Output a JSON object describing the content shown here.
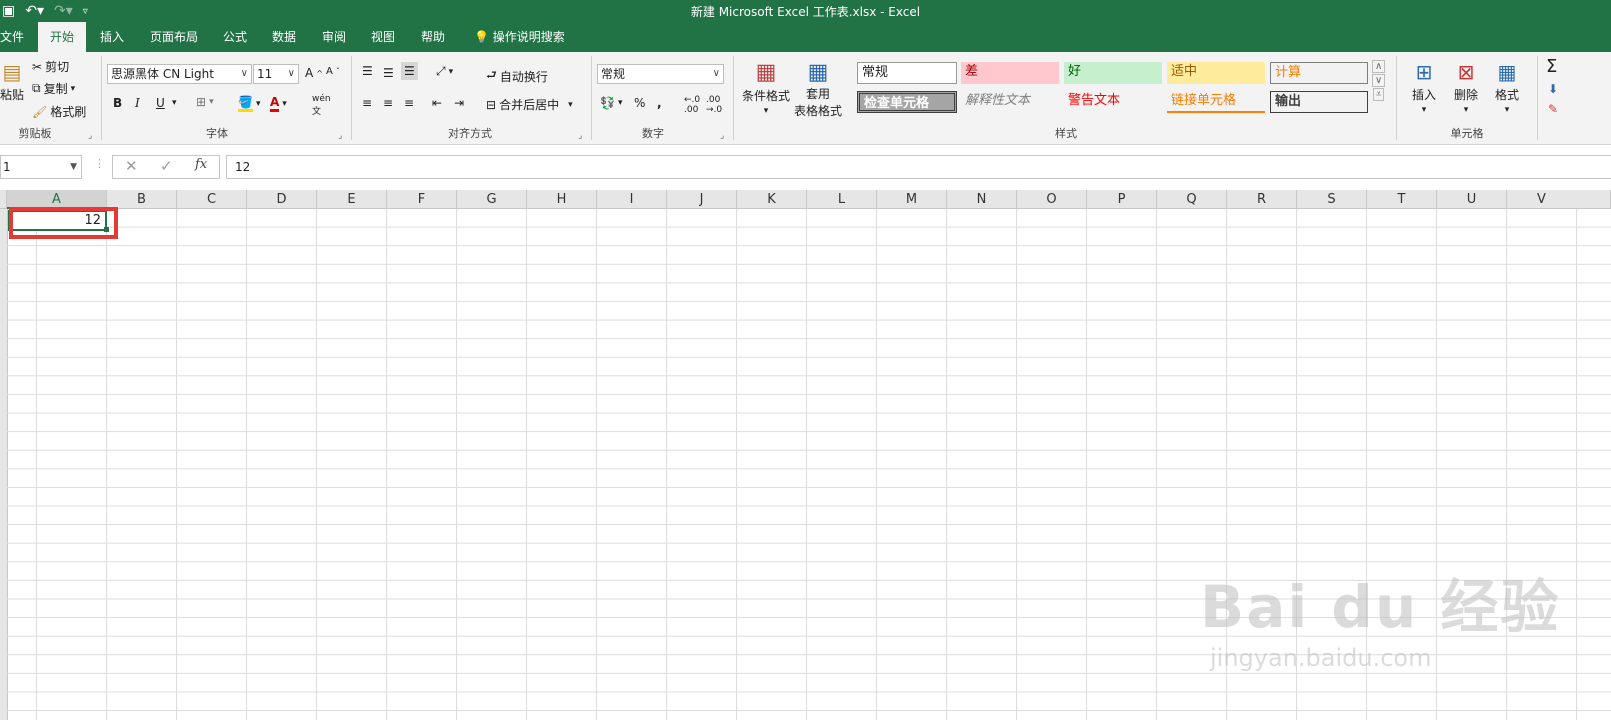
{
  "window": {
    "title": "新建 Microsoft Excel 工作表.xlsx  -  Excel"
  },
  "tabs": [
    {
      "label": "文件",
      "active": false
    },
    {
      "label": "开始",
      "active": true
    },
    {
      "label": "插入",
      "active": false
    },
    {
      "label": "页面布局",
      "active": false
    },
    {
      "label": "公式",
      "active": false
    },
    {
      "label": "数据",
      "active": false
    },
    {
      "label": "审阅",
      "active": false
    },
    {
      "label": "视图",
      "active": false
    },
    {
      "label": "帮助",
      "active": false
    }
  ],
  "search": {
    "label": "操作说明搜索"
  },
  "clipboard": {
    "paste": "粘贴",
    "cut": "剪切",
    "copy": "复制",
    "format_painter": "格式刷",
    "group": "剪贴板"
  },
  "font": {
    "name": "思源黑体 CN Light",
    "size": "11",
    "bold": "B",
    "italic": "I",
    "underline": "U",
    "group": "字体"
  },
  "alignment": {
    "wrap": "自动换行",
    "merge": "合并后居中",
    "group": "对齐方式"
  },
  "number": {
    "format": "常规",
    "group": "数字"
  },
  "styles": {
    "conditional": "条件格式",
    "table_line1": "套用",
    "table_line2": "表格格式",
    "cells": [
      {
        "label": "常规"
      },
      {
        "label": "差"
      },
      {
        "label": "好"
      },
      {
        "label": "适中"
      },
      {
        "label": "计算"
      },
      {
        "label": "检查单元格"
      },
      {
        "label": "解释性文本"
      },
      {
        "label": "警告文本"
      },
      {
        "label": "链接单元格"
      },
      {
        "label": "输出"
      }
    ],
    "group": "样式"
  },
  "cells_group": {
    "insert": "插入",
    "delete": "删除",
    "format": "格式",
    "group": "单元格"
  },
  "formula_bar": {
    "name_box": "1",
    "value": "12"
  },
  "columns": [
    "A",
    "B",
    "C",
    "D",
    "E",
    "F",
    "G",
    "H",
    "I",
    "J",
    "K",
    "L",
    "M",
    "N",
    "O",
    "P",
    "Q",
    "R",
    "S",
    "T",
    "U",
    "V"
  ],
  "cell_a1": {
    "value": "12"
  },
  "watermark": {
    "brand": "Bai  du 经验",
    "url": "jingyan.baidu.com"
  }
}
